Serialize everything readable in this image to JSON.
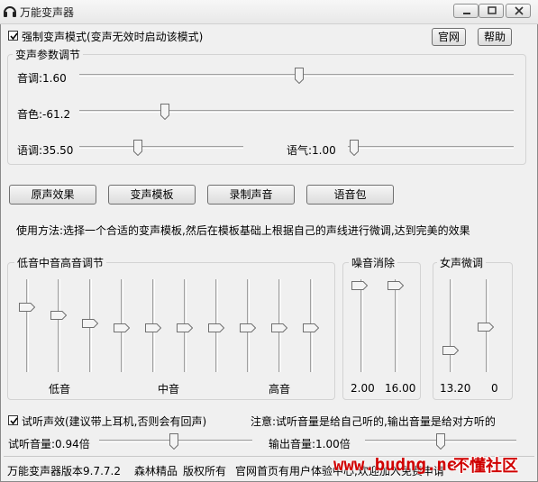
{
  "window": {
    "title": "万能变声器"
  },
  "top": {
    "force_mode_label": "强制变声模式(变声无效时启动该模式)",
    "force_mode_checked": true,
    "website_button": "官网",
    "help_button": "帮助"
  },
  "params": {
    "group_title": "变声参数调节",
    "pitch_label": "音调:1.60",
    "timbre_label": "音色:-61.2",
    "speed_label": "语调:35.50",
    "tone_label": "语气:1.00"
  },
  "buttons": {
    "original": "原声效果",
    "template": "变声模板",
    "record": "录制声音",
    "voice_pack": "语音包"
  },
  "usage_text": "使用方法:选择一个合适的变声模板,然后在模板基础上根据自己的声线进行微调,达到完美的效果",
  "eq": {
    "group_title": "低音中音高音调节",
    "low_label": "低音",
    "mid_label": "中音",
    "high_label": "高音"
  },
  "noise": {
    "group_title": "噪音消除",
    "value_left": "2.00",
    "value_right": "16.00"
  },
  "female": {
    "group_title": "女声微调",
    "value_left": "13.20",
    "value_right": "0"
  },
  "monitor": {
    "checkbox_label": "试听声效(建议带上耳机,否则会有回声)",
    "checked": true,
    "note": "注意:试听音量是给自己听的,输出音量是给对方听的",
    "listen_volume_label": "试听音量:0.94倍",
    "output_volume_label": "输出音量:1.00倍"
  },
  "footer": {
    "version": "万能变声器版本9.7.7.2",
    "brand": "森林精品",
    "copyright": "版权所有",
    "site_text": "官网首页有用户体验中心,欢迎加入免费申请",
    "watermark": "www.budng.net",
    "watermark2": "不懂社区"
  },
  "colors": {
    "watermark_text": "#d00000",
    "watermark_bg": "#003a6e"
  }
}
